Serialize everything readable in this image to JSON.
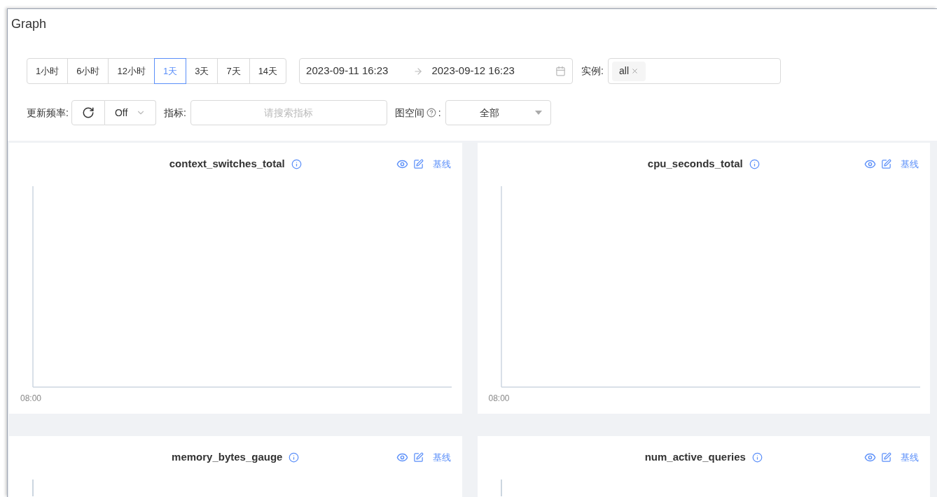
{
  "page": {
    "title": "Graph"
  },
  "time_ranges": [
    {
      "label": "1小时",
      "selected": false
    },
    {
      "label": "6小时",
      "selected": false
    },
    {
      "label": "12小时",
      "selected": false
    },
    {
      "label": "1天",
      "selected": true
    },
    {
      "label": "3天",
      "selected": false
    },
    {
      "label": "7天",
      "selected": false
    },
    {
      "label": "14天",
      "selected": false
    }
  ],
  "date_range": {
    "start": "2023-09-11 16:23",
    "end": "2023-09-12 16:23"
  },
  "instance": {
    "label": "实例:",
    "tags": [
      "all"
    ]
  },
  "refresh": {
    "label": "更新频率:",
    "value": "Off"
  },
  "metric": {
    "label": "指标:",
    "placeholder": "请搜索指标"
  },
  "graph_space": {
    "label": "图空间",
    "colon": ":",
    "value": "全部"
  },
  "panels": [
    {
      "title": "context_switches_total",
      "action": "基线",
      "x_tick": "08:00"
    },
    {
      "title": "cpu_seconds_total",
      "action": "基线",
      "x_tick": "08:00"
    },
    {
      "title": "memory_bytes_gauge",
      "action": "基线"
    },
    {
      "title": "num_active_queries",
      "action": "基线"
    }
  ]
}
